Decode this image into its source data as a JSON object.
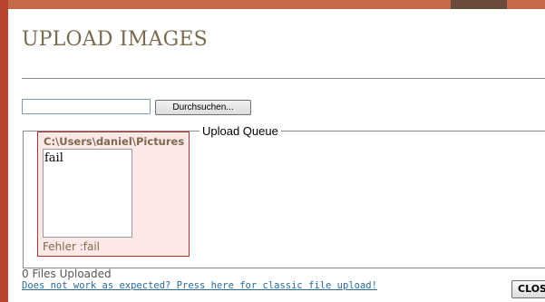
{
  "dialog": {
    "title": "UPLOAD IMAGES",
    "browse_label": "Durchsuchen...",
    "queue_label": "Upload Queue",
    "queue_items": [
      {
        "path": "C:\\Users\\daniel\\Pictures",
        "thumb_text": "fail",
        "error": "Fehler :fail"
      }
    ],
    "files_uploaded": "0 Files Uploaded",
    "classic_link": "Does not work as expected? Press here for classic file upload!",
    "close_label": "CLOSE"
  },
  "colors": {
    "title": "#7a6a4e",
    "error_border": "#b03030",
    "error_bg": "#fde8e8",
    "link": "#2a6a9a"
  }
}
